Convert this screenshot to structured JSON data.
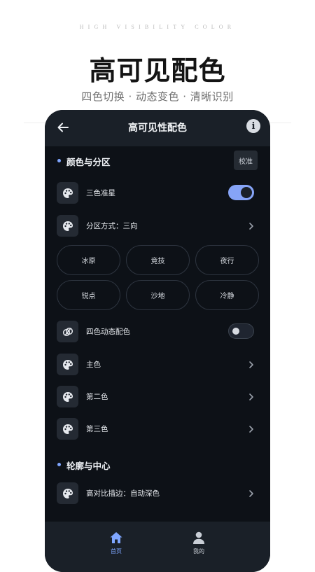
{
  "promo": {
    "tagline": "HIGH VISIBILITY COLOR",
    "title": "高可见配色",
    "subtitle": "四色切换 · 动态变色 · 清晰识别"
  },
  "appbar": {
    "title": "高可见性配色",
    "back_icon": "arrow-left-icon",
    "info_icon": "info-icon",
    "info_glyph": "i"
  },
  "section1": {
    "title": "颜色与分区",
    "calibrate_label": "校准"
  },
  "rows": {
    "tricolor": {
      "label": "三色准星",
      "toggle_on": true
    },
    "partition": {
      "label": "分区方式：三向"
    },
    "dynamic": {
      "label": "四色动态配色",
      "toggle_on": false
    },
    "primary": {
      "label": "主色"
    },
    "secondary": {
      "label": "第二色"
    },
    "tertiary": {
      "label": "第三色"
    }
  },
  "chips": [
    "冰原",
    "竞技",
    "夜行",
    "锐点",
    "沙地",
    "冷静"
  ],
  "section2": {
    "title": "轮廓与中心",
    "outline": {
      "label": "高对比描边：自动深色"
    }
  },
  "nav": {
    "home_label": "首页",
    "mine_label": "我的",
    "active": "home"
  },
  "colors": {
    "accent": "#7fa6ff",
    "toggle_on": "#86a4f7",
    "background": "#0d1117",
    "surface": "#1a2028"
  }
}
